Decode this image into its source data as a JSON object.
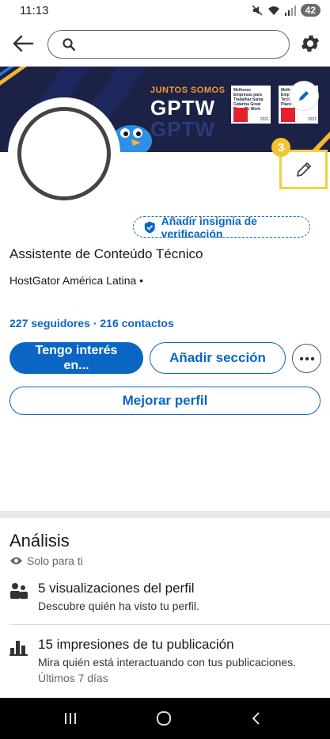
{
  "status_bar": {
    "time": "11:13",
    "battery": "42"
  },
  "search": {
    "value": "",
    "placeholder": ""
  },
  "banner": {
    "tagline": "JUNTOS SOMOS",
    "brand": "GPTW",
    "cert1_text": "Melhores Empresas para Trabalhar Santa Catarina Great Place To Work",
    "cert2_text": "Melhores Empresas Tecnologia Great Place To Work",
    "cert_year": "2021"
  },
  "annotation": {
    "step": "3"
  },
  "profile": {
    "verify_label": "Añadir insignia de verificación",
    "headline": "Assistente de Conteúdo Técnico",
    "company": "HostGator América Latina •",
    "connections": "227 seguidores · 216 contactos"
  },
  "actions": {
    "interest_line1": "Tengo interés",
    "interest_line2": "en...",
    "add_section": "Añadir sección",
    "improve_profile": "Mejorar perfil"
  },
  "analytics": {
    "title": "Análisis",
    "privacy": "Solo para ti",
    "items": [
      {
        "title": "5 visualizaciones del perfil",
        "subtitle": "Descubre quién ha visto tu perfil.",
        "meta": ""
      },
      {
        "title": "15 impresiones de tu publicación",
        "subtitle": "Mira quién está interactuando con tus publicaciones.",
        "meta": "Últimos 7 días"
      }
    ]
  },
  "colors": {
    "accent": "#0a66c2",
    "banner_bg": "#1c2146",
    "annotation": "#f4d03f"
  }
}
